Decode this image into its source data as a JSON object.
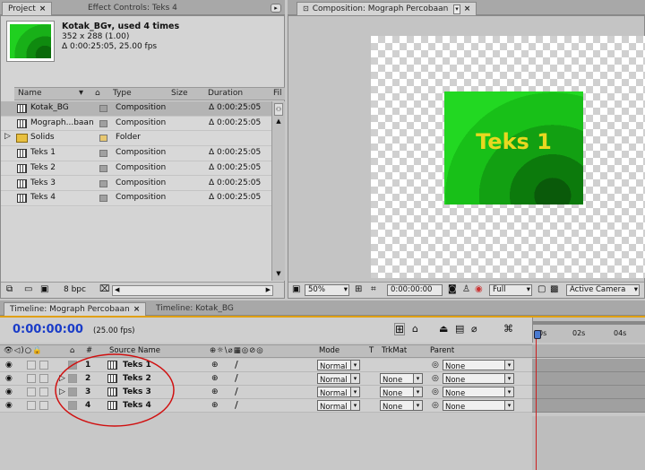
{
  "project_panel": {
    "tabs": [
      {
        "label": "Project",
        "close": "×"
      },
      {
        "label": "Effect Controls: Teks 4"
      }
    ],
    "preview": {
      "name": "Kotak_BG▾, used 4 times",
      "size": "352 x 288 (1.00)",
      "duration": "Δ 0:00:25:05, 25.00 fps"
    },
    "columns": [
      "Name",
      "Type",
      "Size",
      "Duration",
      "Fil"
    ],
    "items": [
      {
        "name": "Kotak_BG",
        "type": "Composition",
        "duration": "Δ 0:00:25:05",
        "icon": "composition-icon",
        "color": "#a0a0a0"
      },
      {
        "name": "Mograph...baan",
        "type": "Composition",
        "duration": "Δ 0:00:25:05",
        "icon": "composition-icon",
        "color": "#a0a0a0"
      },
      {
        "name": "Solids",
        "type": "Folder",
        "duration": "",
        "icon": "folder-icon",
        "color": "#e8c870"
      },
      {
        "name": "Teks 1",
        "type": "Composition",
        "duration": "Δ 0:00:25:05",
        "icon": "composition-icon",
        "color": "#a0a0a0"
      },
      {
        "name": "Teks 2",
        "type": "Composition",
        "duration": "Δ 0:00:25:05",
        "icon": "composition-icon",
        "color": "#a0a0a0"
      },
      {
        "name": "Teks 3",
        "type": "Composition",
        "duration": "Δ 0:00:25:05",
        "icon": "composition-icon",
        "color": "#a0a0a0"
      },
      {
        "name": "Teks 4",
        "type": "Composition",
        "duration": "Δ 0:00:25:05",
        "icon": "composition-icon",
        "color": "#a0a0a0"
      }
    ],
    "footer": {
      "bpc": "8 bpc"
    }
  },
  "comp_panel": {
    "tab": "Composition: Mograph Percobaan",
    "close": "×",
    "canvas_text": "Teks 1",
    "toolbar": {
      "zoom": "50%",
      "timecode": "0:00:00:00",
      "resolution": "Full",
      "camera": "Active Camera"
    }
  },
  "timeline": {
    "tabs": [
      {
        "label": "Timeline: Mograph Percobaan",
        "close": "×"
      },
      {
        "label": "Timeline: Kotak_BG"
      }
    ],
    "timecode": "0:00:00:00",
    "fps": "(25.00 fps)",
    "columns": {
      "num": "#",
      "source": "Source Name",
      "mode": "Mode",
      "t": "T",
      "trkmat": "TrkMat",
      "parent": "Parent"
    },
    "ruler": [
      "0s",
      "02s",
      "04s"
    ],
    "layers": [
      {
        "num": "1",
        "name": "Teks 1",
        "mode": "Normal",
        "trkmat": "",
        "parent": "None"
      },
      {
        "num": "2",
        "name": "Teks 2",
        "mode": "Normal",
        "trkmat": "None",
        "parent": "None"
      },
      {
        "num": "3",
        "name": "Teks 3",
        "mode": "Normal",
        "trkmat": "None",
        "parent": "None"
      },
      {
        "num": "4",
        "name": "Teks 4",
        "mode": "Normal",
        "trkmat": "None",
        "parent": "None"
      }
    ]
  },
  "colors": {
    "accent_timecode": "#1a3cc8",
    "comp_green": "#1fc41f",
    "canvas_text": "#e8d820",
    "annotation_circle": "#d01010",
    "playhead": "#cc2020",
    "timeline_border": "#e0a010"
  }
}
